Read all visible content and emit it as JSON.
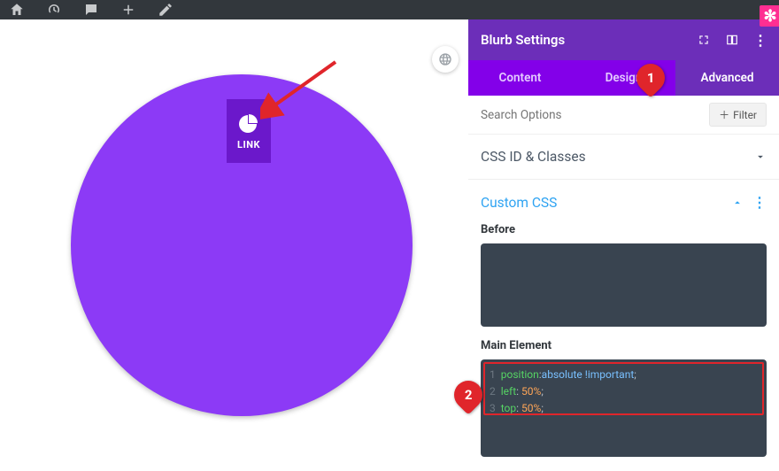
{
  "panel": {
    "title": "Blurb Settings",
    "tabs": {
      "content": "Content",
      "design": "Design",
      "advanced": "Advanced"
    },
    "search_placeholder": "Search Options",
    "filter_label": "Filter",
    "sections": {
      "css_id": "CSS ID & Classes",
      "custom_css": "Custom CSS"
    },
    "fields": {
      "before": "Before",
      "main_element": "Main Element"
    },
    "code": {
      "l1": {
        "num": "1",
        "prop": "position",
        "val": "absolute !important"
      },
      "l2": {
        "num": "2",
        "prop": "left",
        "val": "50%"
      },
      "l3": {
        "num": "3",
        "prop": "top",
        "val": "50%"
      }
    }
  },
  "blurb": {
    "text": "LINK"
  },
  "annotations": {
    "n1": "1",
    "n2": "2"
  }
}
